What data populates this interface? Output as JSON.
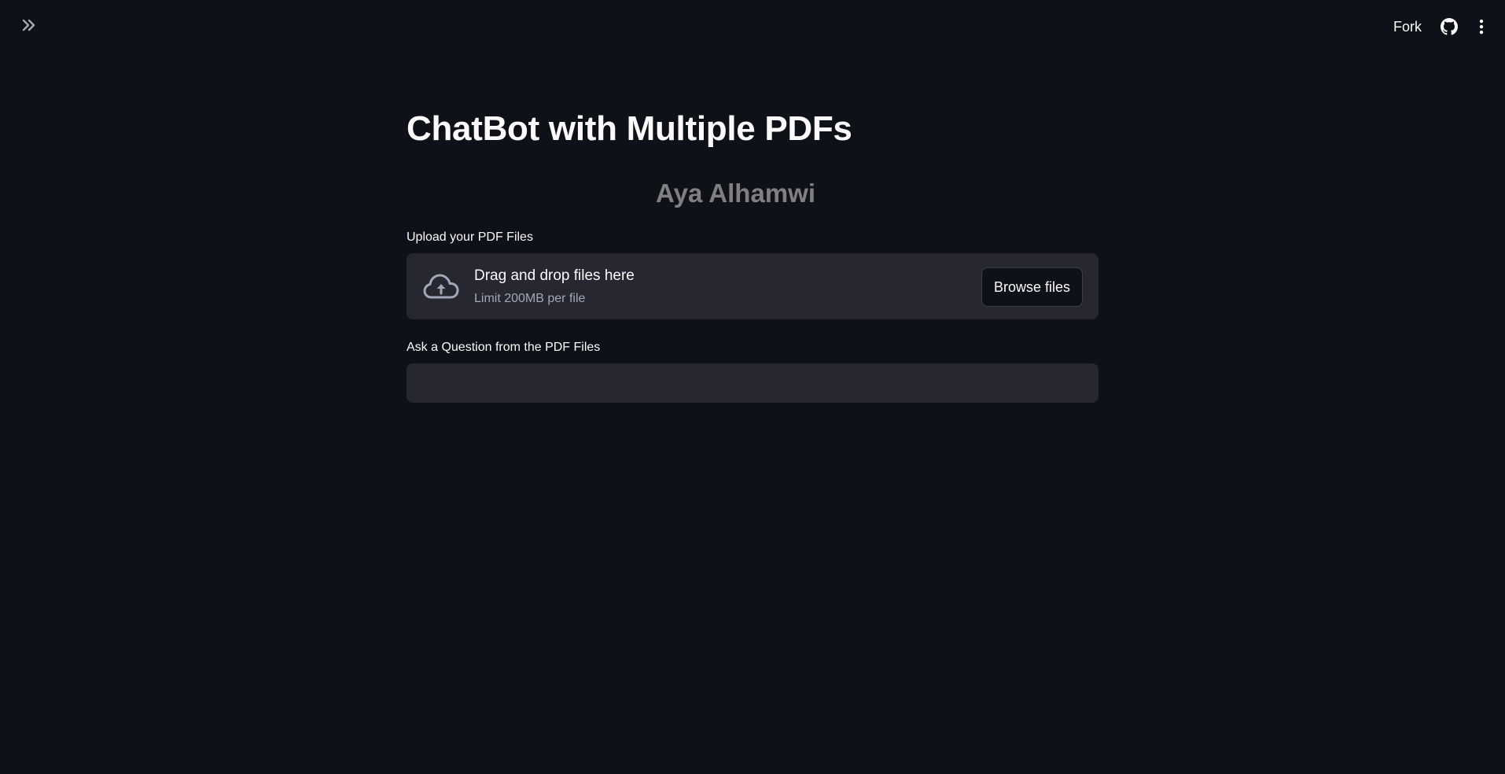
{
  "header": {
    "fork_label": "Fork",
    "icons": [
      "double-chevron-right-icon",
      "github-icon",
      "vertical-dots-menu-icon"
    ]
  },
  "main": {
    "title": "ChatBot with Multiple PDFs",
    "author": "Aya Alhamwi",
    "uploader": {
      "label": "Upload your PDF Files",
      "drop_text": "Drag and drop files here",
      "limit_text": "Limit 200MB per file",
      "browse_label": "Browse files",
      "icon": "cloud-upload-icon"
    },
    "question": {
      "label": "Ask a Question from the PDF Files",
      "value": ""
    }
  },
  "colors": {
    "background": "#0e1117",
    "surface": "#262730",
    "text": "#fafafa",
    "muted_text": "#808080",
    "secondary_text": "#a3a8b8",
    "border": "#3b3e48"
  }
}
